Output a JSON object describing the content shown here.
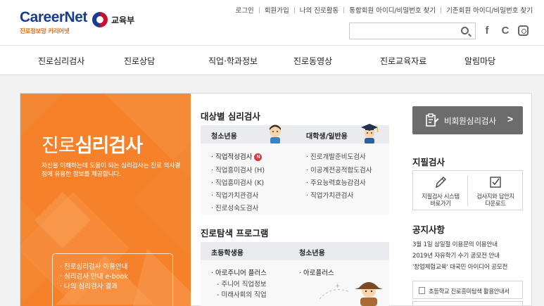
{
  "header": {
    "logo_main": "CareerNet",
    "logo_sub": "진로정보망 커리어넷",
    "ministry": "교육부",
    "util_links": [
      "로그인",
      "회원가입",
      "나의 진로활동",
      "통합회원 아이디/비밀번호 찾기",
      "기존회원 아이디/비밀번호 찾기"
    ],
    "search_placeholder": "",
    "sns": {
      "facebook": "f",
      "cs": "C"
    }
  },
  "nav": [
    "진로심리검사",
    "진로상담",
    "직업·학과정보",
    "진로동영상",
    "진로교육자료",
    "알림마당"
  ],
  "hero": {
    "title_light": "진로",
    "title_bold": "심리검사",
    "desc": "자신을 이해하는데 도움이 되는 심리검사는 진로 의사결정에 유용한 정보를 제공합니다.",
    "links": [
      "· 진로심리검사 이용안내",
      "· 심리검사 안내 e-book",
      "· 나의 심리검사 결과"
    ]
  },
  "target_tests": {
    "title": "대상별 심리검사",
    "youth_label": "청소년용",
    "adult_label": "대학생/일반용",
    "youth_items": [
      "· 직업적성검사",
      "· 직업흥미검사 (H)",
      "· 직업흥미검사 (K)",
      "· 직업가치관검사",
      "· 진로성숙도검사"
    ],
    "new_badge": "N",
    "adult_items": [
      "· 진로개발준비도검사",
      "· 이공계전공적합도검사",
      "· 주요능력효능감검사",
      "· 직업가치관검사"
    ]
  },
  "explore": {
    "title": "진로탐색 프로그램",
    "elem_label": "초등학생용",
    "youth_label": "청소년용",
    "elem_items": [
      "· 아로주니어 플러스",
      "- 주니어 직업정보",
      "- 미래사회의 직업"
    ],
    "youth_items": [
      "· 아로플러스"
    ]
  },
  "right": {
    "nonmember_label": "비회원심리검사",
    "paper_title": "지필검사",
    "paper_left": "지필검사 시스템\n바로가기",
    "paper_right": "검사지와 답안지\n다운로드",
    "notice_title": "공지사항",
    "notices": [
      "3월 1일 삼일절 이용문의 이용안내",
      "2019년 자유학기 수기 공모전 안내",
      "'창업체험교육' 대국민 아이디어 공모전"
    ],
    "guide_label": "초등학교 진로흥미탐색 활용안내서"
  },
  "colors": {
    "orange": "#f5822a",
    "navy": "#1a3c8f",
    "grey_button": "#6c6c6c",
    "new_badge": "#e5333e"
  }
}
